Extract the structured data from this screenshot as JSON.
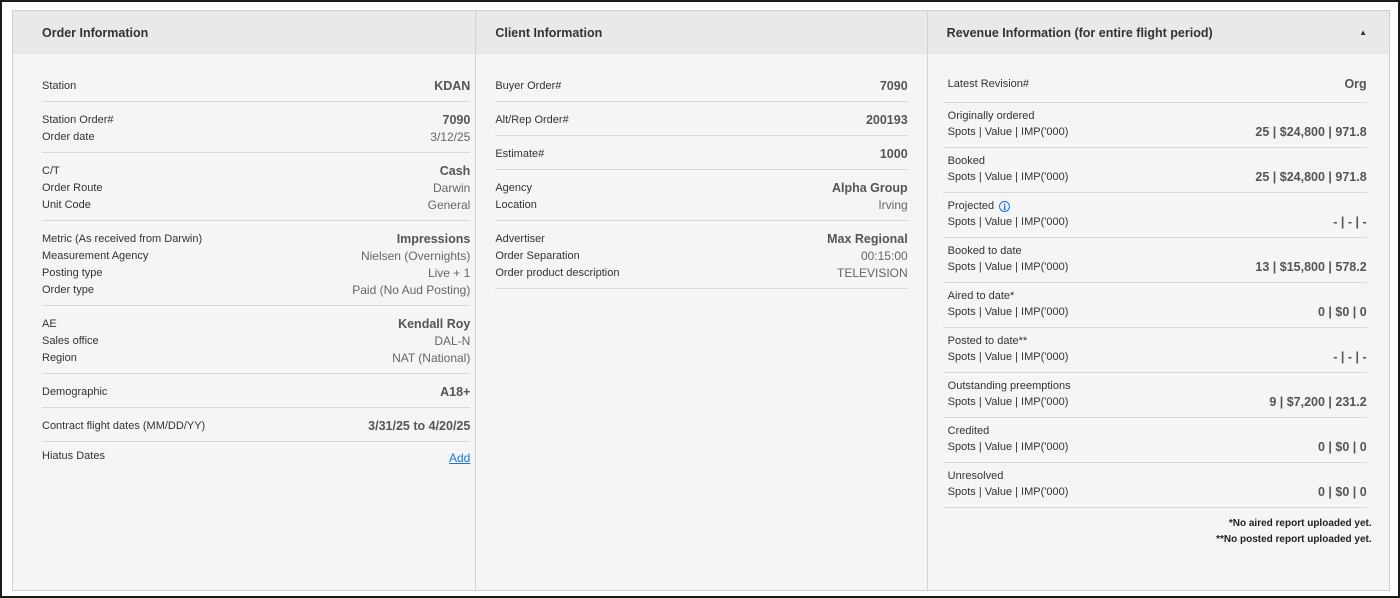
{
  "order_info": {
    "title": "Order Information",
    "groups": [
      [
        {
          "label": "Station",
          "value": "KDAN",
          "bold": true
        }
      ],
      [
        {
          "label": "Station Order#",
          "value": "7090",
          "bold": true
        },
        {
          "label": "Order date",
          "value": "3/12/25",
          "bold": false
        }
      ],
      [
        {
          "label": "C/T",
          "value": "Cash",
          "bold": true
        },
        {
          "label": "Order Route",
          "value": "Darwin",
          "bold": false
        },
        {
          "label": "Unit Code",
          "value": "General",
          "bold": false
        }
      ],
      [
        {
          "label": "Metric (As received from Darwin)",
          "value": "Impressions",
          "bold": true
        },
        {
          "label": "Measurement Agency",
          "value": "Nielsen (Overnights)",
          "bold": false
        },
        {
          "label": "Posting type",
          "value": "Live + 1",
          "bold": false
        },
        {
          "label": "Order type",
          "value": "Paid (No Aud Posting)",
          "bold": false
        }
      ],
      [
        {
          "label": "AE",
          "value": "Kendall Roy",
          "bold": true
        },
        {
          "label": "Sales office",
          "value": "DAL-N",
          "bold": false
        },
        {
          "label": "Region",
          "value": "NAT (National)",
          "bold": false
        }
      ],
      [
        {
          "label": "Demographic",
          "value": "A18+",
          "bold": true
        }
      ],
      [
        {
          "label": "Contract flight dates (MM/DD/YY)",
          "value": "3/31/25 to 4/20/25",
          "bold": true
        }
      ]
    ],
    "hiatus": {
      "label": "Hiatus Dates",
      "link": "Add"
    }
  },
  "client_info": {
    "title": "Client Information",
    "groups": [
      [
        {
          "label": "Buyer Order#",
          "value": "7090",
          "bold": true
        }
      ],
      [
        {
          "label": "Alt/Rep Order#",
          "value": "200193",
          "bold": true
        }
      ],
      [
        {
          "label": "Estimate#",
          "value": "1000",
          "bold": true
        }
      ],
      [
        {
          "label": "Agency",
          "value": "Alpha Group",
          "bold": true
        },
        {
          "label": "Location",
          "value": "Irving",
          "bold": false
        }
      ],
      [
        {
          "label": "Advertiser",
          "value": "Max Regional",
          "bold": true
        },
        {
          "label": "Order Separation",
          "value": "00:15:00",
          "bold": false
        },
        {
          "label": "Order product description",
          "value": "TELEVISION",
          "bold": false
        }
      ]
    ]
  },
  "revenue_info": {
    "title": "Revenue Information (for entire flight period)",
    "collapse_icon": "caret-up",
    "latest_revision": {
      "label": "Latest Revision#",
      "value": "Org"
    },
    "items": [
      {
        "title": "Originally ordered",
        "sub": "Spots | Value | IMP('000)",
        "value": "25 | $24,800 | 971.8",
        "info": false
      },
      {
        "title": "Booked",
        "sub": "Spots | Value | IMP('000)",
        "value": "25 | $24,800 | 971.8",
        "info": false
      },
      {
        "title": "Projected",
        "sub": "Spots | Value | IMP('000)",
        "value": "- | - | -",
        "info": true
      },
      {
        "title": "Booked to date",
        "sub": "Spots | Value | IMP('000)",
        "value": "13 | $15,800 | 578.2",
        "info": false
      },
      {
        "title": "Aired to date*",
        "sub": "Spots | Value | IMP('000)",
        "value": "0 | $0 | 0",
        "info": false
      },
      {
        "title": "Posted to date**",
        "sub": "Spots | Value | IMP('000)",
        "value": "- | - | -",
        "info": false
      },
      {
        "title": "Outstanding preemptions",
        "sub": "Spots | Value | IMP('000)",
        "value": "9 | $7,200 | 231.2",
        "info": false
      },
      {
        "title": "Credited",
        "sub": "Spots | Value | IMP('000)",
        "value": "0 | $0 | 0",
        "info": false
      },
      {
        "title": "Unresolved",
        "sub": "Spots | Value | IMP('000)",
        "value": "0 | $0 | 0",
        "info": false
      }
    ],
    "footnotes": [
      "*No aired report uploaded yet.",
      "**No posted report uploaded yet."
    ]
  }
}
